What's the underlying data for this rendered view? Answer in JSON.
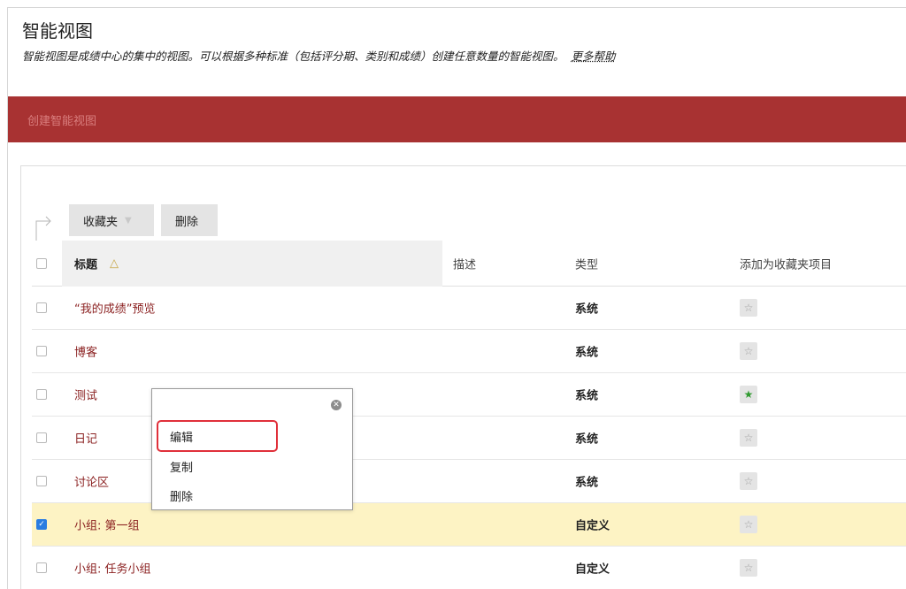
{
  "page": {
    "title": "智能视图",
    "description": "智能视图是成绩中心的集中的视图。可以根据多种标准（包括评分期、类别和成绩）创建任意数量的智能视图。",
    "help_link": "更多帮助"
  },
  "action_bar": {
    "create_label": "创建智能视图",
    "color": "#a83232"
  },
  "toolbar": {
    "favorites_label": "收藏夹",
    "delete_label": "删除"
  },
  "table": {
    "headers": {
      "title": "标题",
      "description": "描述",
      "type": "类型",
      "favorite": "添加为收藏夹项目"
    },
    "sort": "ascending",
    "rows": [
      {
        "title": "“我的成绩”预览",
        "type": "系统",
        "checked": false,
        "favorite": false
      },
      {
        "title": "博客",
        "type": "系统",
        "checked": false,
        "favorite": false
      },
      {
        "title": "测试",
        "type": "系统",
        "checked": false,
        "favorite": true
      },
      {
        "title": "日记",
        "type": "系统",
        "checked": false,
        "favorite": false
      },
      {
        "title": "讨论区",
        "type": "系统",
        "checked": false,
        "favorite": false
      },
      {
        "title": "小组: 第一组",
        "type": "自定义",
        "checked": true,
        "favorite": false
      },
      {
        "title": "小组: 任务小组",
        "type": "自定义",
        "checked": false,
        "favorite": false
      }
    ]
  },
  "context_menu": {
    "items": [
      "编辑",
      "复制",
      "删除"
    ],
    "highlighted": "编辑"
  },
  "colors": {
    "link": "#8a1f1f",
    "selected_row": "#fdf3c4",
    "favorite_on": "#2f9a2f",
    "highlight_border": "#e0303a"
  }
}
